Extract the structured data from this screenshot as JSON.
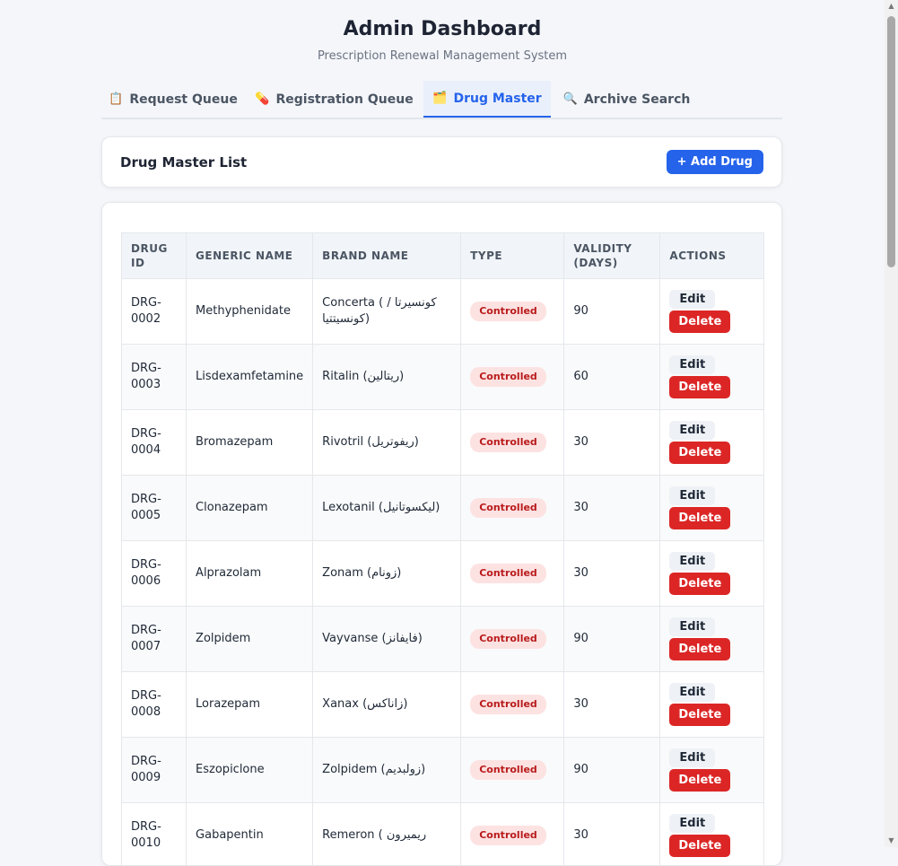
{
  "header": {
    "title": "Admin Dashboard",
    "subtitle": "Prescription Renewal Management System"
  },
  "tabs": [
    {
      "icon": "📋",
      "label": "Request Queue"
    },
    {
      "icon": "💊",
      "label": "Registration Queue"
    },
    {
      "icon": "🗂️",
      "label": "Drug Master"
    },
    {
      "icon": "🔍",
      "label": "Archive Search"
    }
  ],
  "drug_list": {
    "title": "Drug Master List",
    "add_label": "+ Add Drug"
  },
  "table": {
    "columns": [
      "Drug ID",
      "Generic Name",
      "Brand Name",
      "Type",
      "Validity (Days)",
      "Actions"
    ],
    "edit_label": "Edit",
    "delete_label": "Delete",
    "rows": [
      {
        "id": "DRG-0002",
        "generic": "Methyphenidate",
        "brand": "Concerta ( كونسيرتا / كونسيتتيا)",
        "type": "Controlled",
        "validity": "90"
      },
      {
        "id": "DRG-0003",
        "generic": "Lisdexamfetamine",
        "brand": "Ritalin (ريتالين)",
        "type": "Controlled",
        "validity": "60"
      },
      {
        "id": "DRG-0004",
        "generic": "Bromazepam",
        "brand": "Rivotril (ريفوتريل)",
        "type": "Controlled",
        "validity": "30"
      },
      {
        "id": "DRG-0005",
        "generic": "Clonazepam",
        "brand": "Lexotanil (ليكسوتانيل)",
        "type": "Controlled",
        "validity": "30"
      },
      {
        "id": "DRG-0006",
        "generic": "Alprazolam",
        "brand": "Zonam (زونام)",
        "type": "Controlled",
        "validity": "30"
      },
      {
        "id": "DRG-0007",
        "generic": "Zolpidem",
        "brand": "Vayvanse (فايفانز)",
        "type": "Controlled",
        "validity": "90"
      },
      {
        "id": "DRG-0008",
        "generic": "Lorazepam",
        "brand": "Xanax (زاناكس)",
        "type": "Controlled",
        "validity": "30"
      },
      {
        "id": "DRG-0009",
        "generic": "Eszopiclone",
        "brand": "Zolpidem (زولبديم)",
        "type": "Controlled",
        "validity": "90"
      },
      {
        "id": "DRG-0010",
        "generic": "Gabapentin",
        "brand": "Remeron ( ريميرون",
        "type": "Controlled",
        "validity": "30"
      }
    ]
  }
}
